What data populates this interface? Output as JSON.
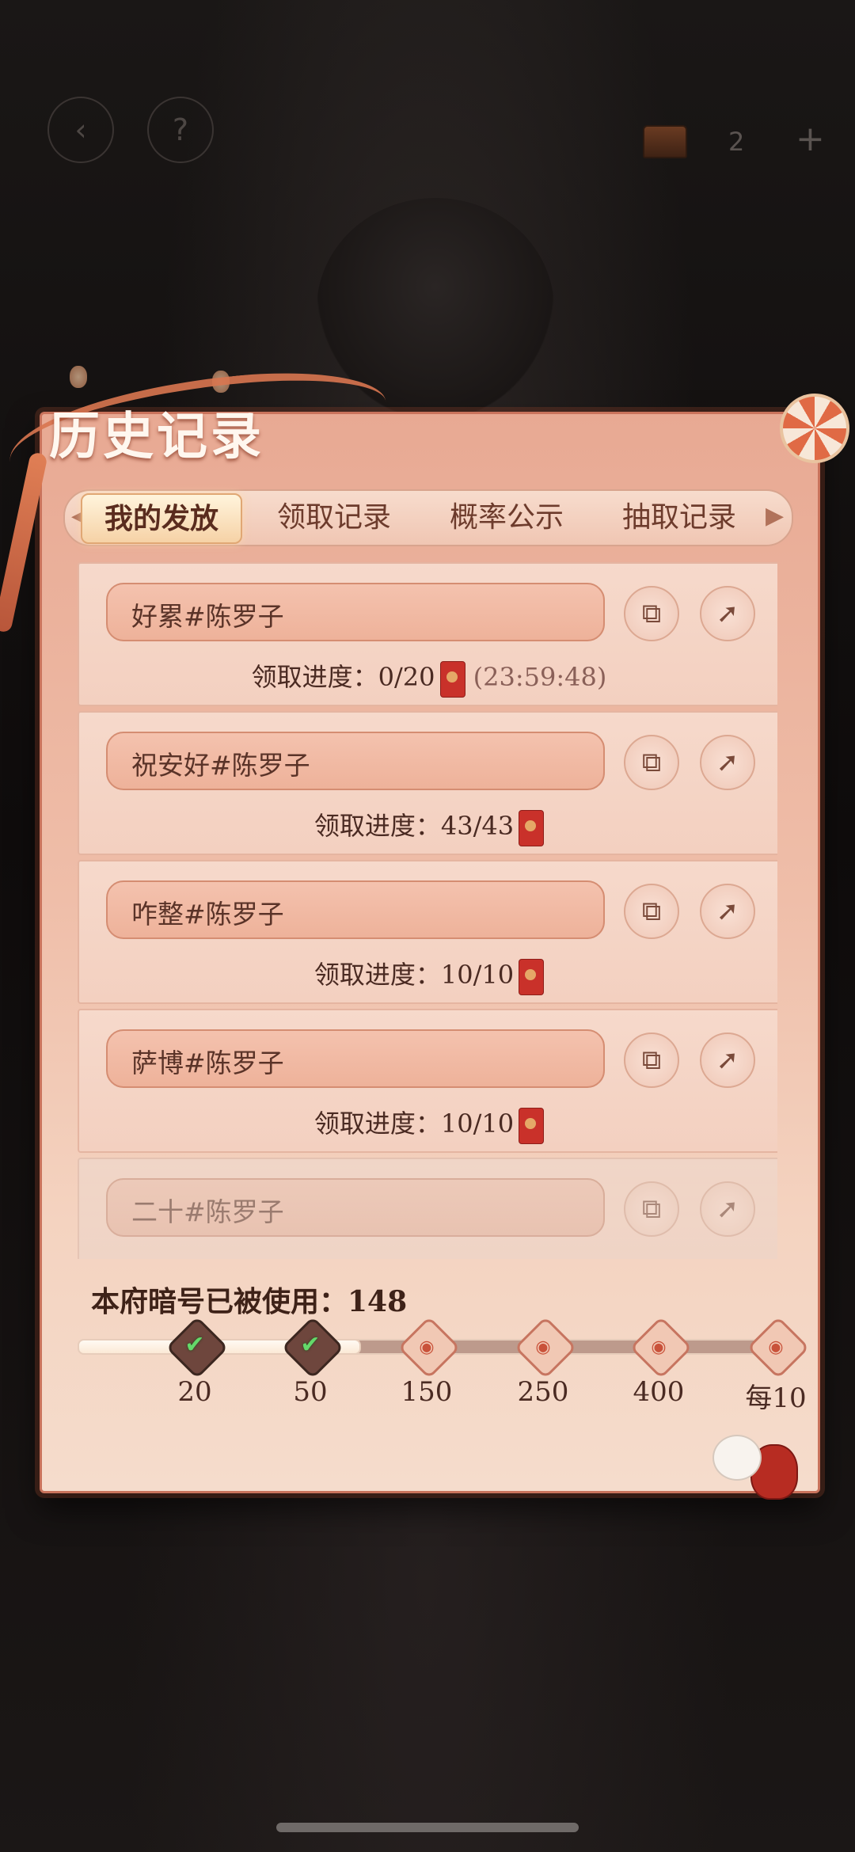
{
  "topbar": {
    "back_icon": "back-arrow-icon",
    "help_label": "?",
    "chest_icon": "treasure-chest-icon",
    "count": "2",
    "plus_label": "+"
  },
  "panel": {
    "title": "历史记录"
  },
  "tabs": [
    {
      "label": "我的发放",
      "active": true
    },
    {
      "label": "领取记录",
      "active": false
    },
    {
      "label": "概率公示",
      "active": false
    },
    {
      "label": "抽取记录",
      "active": false
    }
  ],
  "records": [
    {
      "name": "好累#陈罗子",
      "progress_label": "领取进度：",
      "progress": "0/20",
      "timer": "(23:59:48)"
    },
    {
      "name": "祝安好#陈罗子",
      "progress_label": "领取进度：",
      "progress": "43/43",
      "timer": ""
    },
    {
      "name": "咋整#陈罗子",
      "progress_label": "领取进度：",
      "progress": "10/10",
      "timer": ""
    },
    {
      "name": "萨博#陈罗子",
      "progress_label": "领取进度：",
      "progress": "10/10",
      "timer": ""
    },
    {
      "name": "二十#陈罗子",
      "progress_label": "",
      "progress": "",
      "timer": ""
    }
  ],
  "usage": {
    "label": "本府暗号已被使用：148",
    "used": 148,
    "milestones": [
      {
        "label": "20",
        "done": true
      },
      {
        "label": "50",
        "done": true
      },
      {
        "label": "150",
        "done": false
      },
      {
        "label": "250",
        "done": false
      },
      {
        "label": "400",
        "done": false
      },
      {
        "label": "每10",
        "done": false
      }
    ],
    "check_glyph": "✔",
    "coin_glyph": "◉"
  },
  "icons": {
    "copy": "⧉",
    "share": "➚"
  },
  "colors": {
    "panel_top": "#e8a993",
    "accent_red": "#c9312a",
    "check_green": "#64d96a"
  }
}
